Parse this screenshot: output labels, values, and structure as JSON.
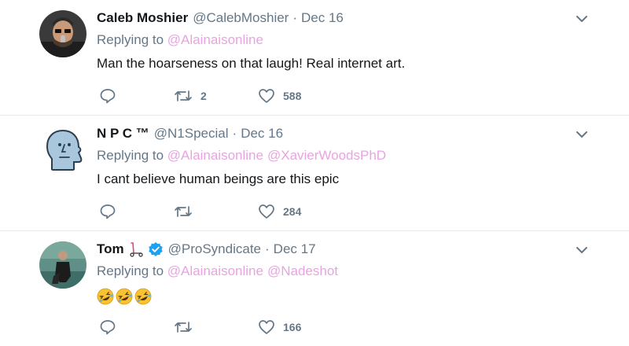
{
  "tweets": [
    {
      "name": "Caleb Moshier",
      "handle": "@CalebMoshier",
      "separator": "·",
      "date": "Dec 16",
      "replying_label": "Replying to",
      "mentions": [
        "@Alainaisonline"
      ],
      "text": "Man the hoarseness on that laugh!  Real internet art.",
      "reply_count": "",
      "retweet_count": "2",
      "like_count": "588",
      "avatar_icon": "person-headphones-avatar"
    },
    {
      "name": "N P C ™",
      "handle": "@N1Special",
      "separator": "·",
      "date": "Dec 16",
      "replying_label": "Replying to",
      "mentions": [
        "@Alainaisonline",
        "@XavierWoodsPhD"
      ],
      "text": "I cant believe human beings are this epic",
      "reply_count": "",
      "retweet_count": "",
      "like_count": "284",
      "avatar_icon": "npc-face-avatar"
    },
    {
      "name": "Tom",
      "handle": "@ProSyndicate",
      "separator": "·",
      "date": "Dec 17",
      "replying_label": "Replying to",
      "mentions": [
        "@Alainaisonline",
        "@Nadeshot"
      ],
      "text": "",
      "emojis": [
        "🤣",
        "🤣",
        "🤣"
      ],
      "reply_count": "",
      "retweet_count": "",
      "like_count": "166",
      "avatar_icon": "person-by-water-avatar",
      "name_emoji_icon": "scooter-icon",
      "verified_icon": "verified-badge-icon"
    }
  ],
  "colors": {
    "text": "#14171a",
    "muted": "#657786",
    "mention": "#e8a4e0",
    "verified": "#1da1f2",
    "divider": "#e6ecf0"
  }
}
